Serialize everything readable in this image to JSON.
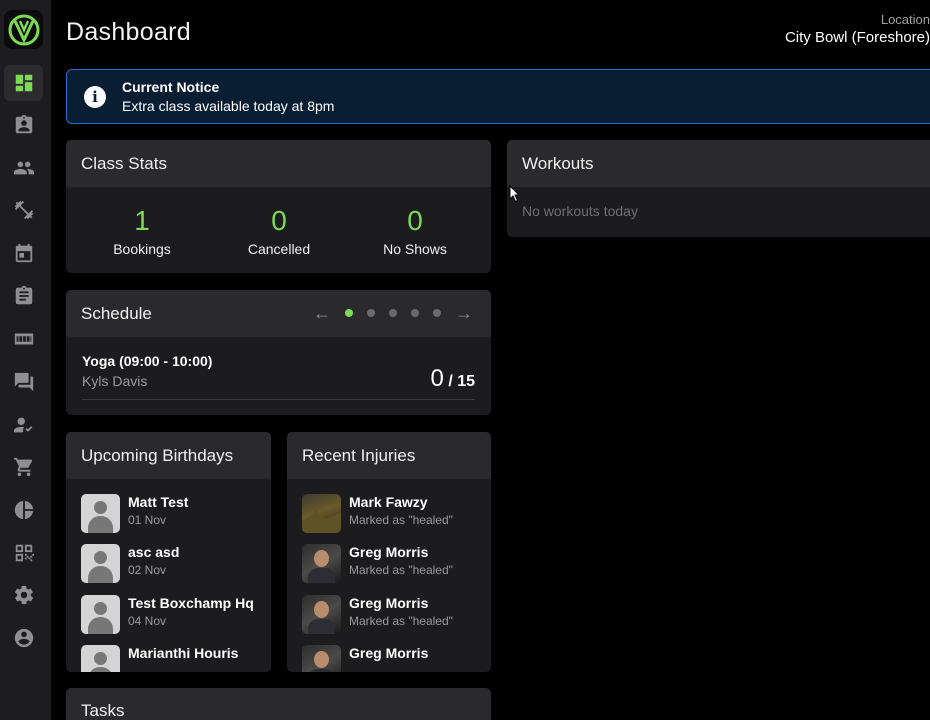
{
  "header": {
    "title": "Dashboard",
    "location_label": "Location",
    "location_value": "City Bowl (Foreshore)"
  },
  "notice": {
    "title": "Current Notice",
    "body": "Extra class available today at 8pm"
  },
  "class_stats": {
    "title": "Class Stats",
    "items": [
      {
        "value": "1",
        "label": "Bookings"
      },
      {
        "value": "0",
        "label": "Cancelled"
      },
      {
        "value": "0",
        "label": "No Shows"
      }
    ]
  },
  "workouts": {
    "title": "Workouts",
    "empty": "No workouts today"
  },
  "schedule": {
    "title": "Schedule",
    "class_name": "Yoga (09:00 - 10:00)",
    "instructor": "Kyls Davis",
    "booked": "0",
    "capacity": "/ 15",
    "pages": 5,
    "active_page": 1
  },
  "birthdays": {
    "title": "Upcoming Birthdays",
    "items": [
      {
        "name": "Matt Test",
        "date": "01 Nov"
      },
      {
        "name": "asc asd",
        "date": "02 Nov"
      },
      {
        "name": "Test Boxchamp Hq",
        "date": "04 Nov"
      },
      {
        "name": "Marianthi Houris",
        "date": ""
      }
    ]
  },
  "injuries": {
    "title": "Recent Injuries",
    "items": [
      {
        "name": "Mark Fawzy",
        "status": "Marked as \"healed\""
      },
      {
        "name": "Greg Morris",
        "status": "Marked as \"healed\""
      },
      {
        "name": "Greg Morris",
        "status": "Marked as \"healed\""
      },
      {
        "name": "Greg Morris",
        "status": ""
      }
    ]
  },
  "tasks": {
    "title": "Tasks"
  },
  "colors": {
    "accent": "#7ed957",
    "notice_border": "#2a6bd1",
    "card": "#1c1c1e",
    "card_header": "#2a2a2c"
  },
  "sidebar": {
    "items": [
      {
        "icon": "dashboard-icon",
        "active": true
      },
      {
        "icon": "clipboard-account-icon"
      },
      {
        "icon": "people-icon"
      },
      {
        "icon": "dumbbell-icon"
      },
      {
        "icon": "calendar-icon"
      },
      {
        "icon": "clipboard-icon"
      },
      {
        "icon": "scoreboard-icon"
      },
      {
        "icon": "chat-icon"
      },
      {
        "icon": "person-check-icon"
      },
      {
        "icon": "cart-icon"
      },
      {
        "icon": "pie-chart-icon"
      },
      {
        "icon": "qr-code-icon"
      },
      {
        "icon": "gear-icon"
      },
      {
        "icon": "account-circle-icon"
      }
    ]
  }
}
